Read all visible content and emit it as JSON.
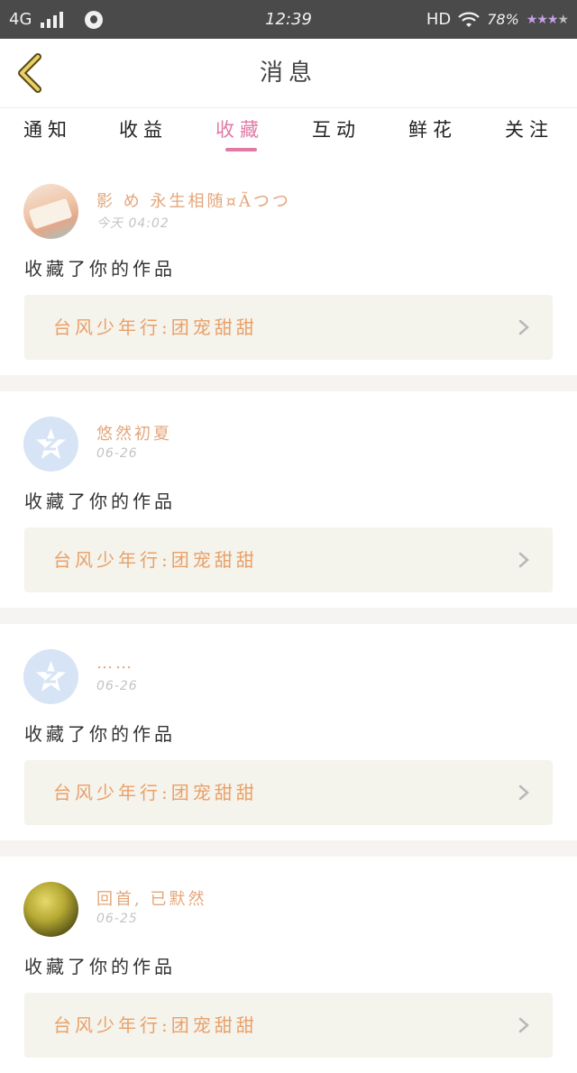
{
  "status_bar": {
    "network": "4G",
    "time": "12:39",
    "hd": "HD",
    "battery": "78%",
    "icons": [
      "signal-icon",
      "qq-icon",
      "wifi-icon",
      "star-rating-icon"
    ]
  },
  "header": {
    "title": "消息",
    "back_icon": "chevron-left-icon"
  },
  "tabs": [
    {
      "label": "通知",
      "active": false
    },
    {
      "label": "收益",
      "active": false
    },
    {
      "label": "收藏",
      "active": true
    },
    {
      "label": "互动",
      "active": false
    },
    {
      "label": "鲜花",
      "active": false
    },
    {
      "label": "关注",
      "active": false
    }
  ],
  "colors": {
    "accent": "#e07aa5",
    "name": "#e4a67a",
    "work_title": "#eaa068",
    "work_bg": "#f4f3ec"
  },
  "messages": [
    {
      "name": "影 め 永生相随¤Ãつつ",
      "time": "今天 04:02",
      "desc": "收藏了你的作品",
      "work_title": "台风少年行:团宠甜甜",
      "avatar": "book-photo"
    },
    {
      "name": "悠然初夏",
      "time": "06-26",
      "desc": "收藏了你的作品",
      "work_title": "台风少年行:团宠甜甜",
      "avatar": "qq-default"
    },
    {
      "name": "……",
      "time": "06-26",
      "desc": "收藏了你的作品",
      "work_title": "台风少年行:团宠甜甜",
      "avatar": "qq-default"
    },
    {
      "name": "回首, 已默然",
      "time": "06-25",
      "desc": "收藏了你的作品",
      "work_title": "台风少年行:团宠甜甜",
      "avatar": "forest-photo"
    }
  ]
}
